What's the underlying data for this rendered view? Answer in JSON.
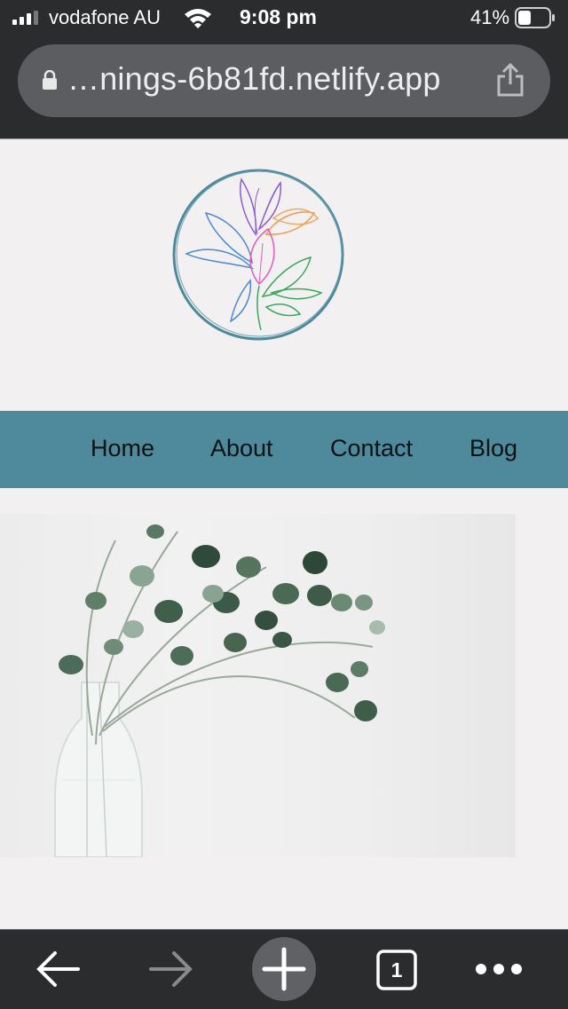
{
  "status": {
    "carrier": "vodafone AU",
    "time": "9:08 pm",
    "battery_percent": "41%"
  },
  "browser": {
    "url": "…nings-6b81fd.netlify.app",
    "open_tabs": "1"
  },
  "nav": {
    "items": [
      "Home",
      "About",
      "Contact",
      "Blog"
    ]
  },
  "icons": {
    "signal": "signal-bars-icon",
    "wifi": "wifi-icon",
    "battery": "battery-icon",
    "lock": "lock-icon",
    "share": "share-icon",
    "back": "back-arrow-icon",
    "forward": "forward-arrow-icon",
    "new_tab": "plus-icon",
    "tabs": "tabs-icon",
    "more": "more-icon"
  },
  "colors": {
    "nav_background": "#4e8a9c",
    "page_background": "#f2f0f1",
    "chrome_background": "#2b2c2e",
    "logo_ring": "#4e8a9c"
  }
}
